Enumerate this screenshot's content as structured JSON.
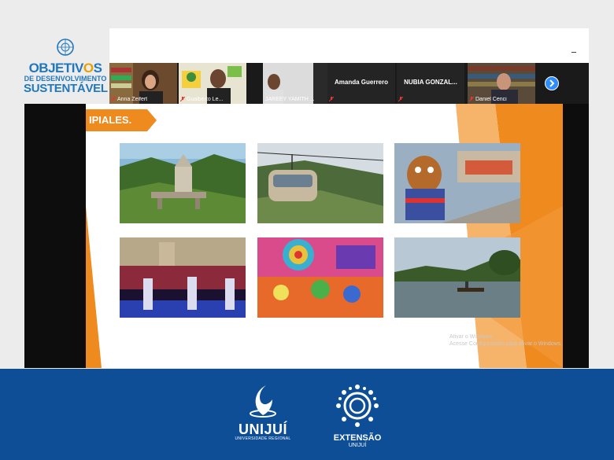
{
  "sdg_logo": {
    "line1_pre": "OBJETIV",
    "line1_o": "O",
    "line1_post": "S",
    "line2": "DE DESENVOLVIMENTO",
    "line3": "SUSTENTÁVEL"
  },
  "meeting": {
    "participants": [
      {
        "name": "Anna Zeifert",
        "video": true
      },
      {
        "name": "Gualberto Le...",
        "video": true
      },
      {
        "name": "JAREEY YAMITH ...",
        "video": true,
        "active": true
      },
      {
        "name": "Amanda Guerrero",
        "video": false
      },
      {
        "name": "NUBIA GONZAL...",
        "video": false
      },
      {
        "name": "Daniel Cenci",
        "video": true
      }
    ]
  },
  "slide": {
    "title": "IPIALES.",
    "accent_color": "#ef8a1f",
    "watermark_line1": "Ativar o Windows",
    "watermark_line2": "Acesse Configurações para ativar o Windows."
  },
  "footer": {
    "bg_color": "#0d4e96",
    "unijui_word": "UNIJUÍ",
    "unijui_sub": "UNIVERSIDADE REGIONAL",
    "extensao_word": "EXTENSÃO",
    "extensao_sub": "UNIJUÍ"
  }
}
